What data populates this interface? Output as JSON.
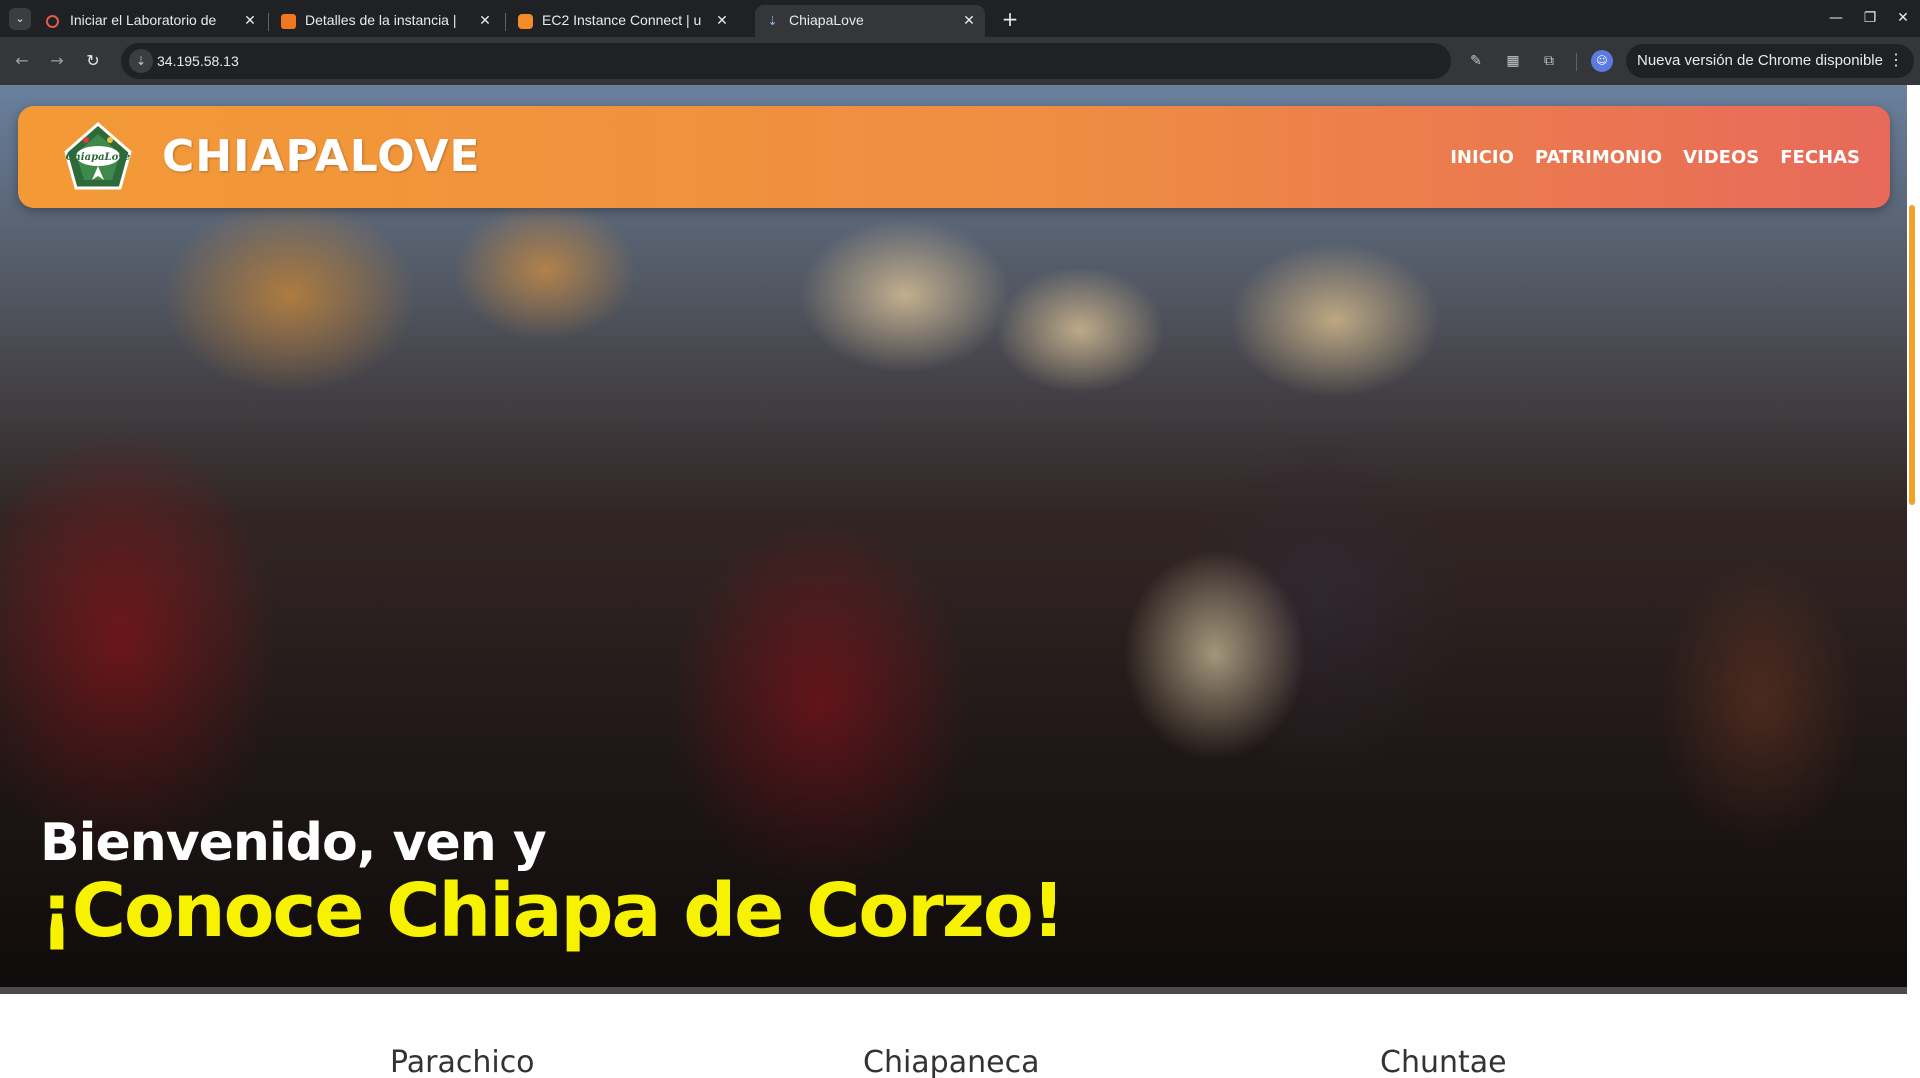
{
  "browser": {
    "tabs": [
      {
        "title": "Iniciar el Laboratorio de",
        "favicon": "loading-spinner-icon",
        "active": false
      },
      {
        "title": "Detalles de la instancia |",
        "favicon": "aws-orange-icon",
        "active": false
      },
      {
        "title": "EC2 Instance Connect | u",
        "favicon": "aws-orange-hex-icon",
        "active": false
      },
      {
        "title": "ChiapaLove",
        "favicon": "site-icon",
        "active": true
      }
    ],
    "address": "34.195.58.13",
    "update_notice": "Nueva versión de Chrome disponible",
    "colors": {
      "frame": "#202124",
      "toolbar": "#35363a"
    }
  },
  "site": {
    "brand": "CHIAPALOVE",
    "logo_text": "ChiapaLove",
    "nav": [
      "INICIO",
      "PATRIMONIO",
      "VIDEOS",
      "FECHAS"
    ],
    "hero": {
      "line1": "Bienvenido, ven y",
      "line2": "¡Conoce Chiapa de Corzo!"
    },
    "cards": [
      "Parachico",
      "Chiapaneca",
      "Chuntae"
    ],
    "colors": {
      "navbar_start": "#f39a36",
      "navbar_end": "#e8695a",
      "hero_highlight": "#f7f200",
      "scrollbar": "#f2a227"
    }
  }
}
